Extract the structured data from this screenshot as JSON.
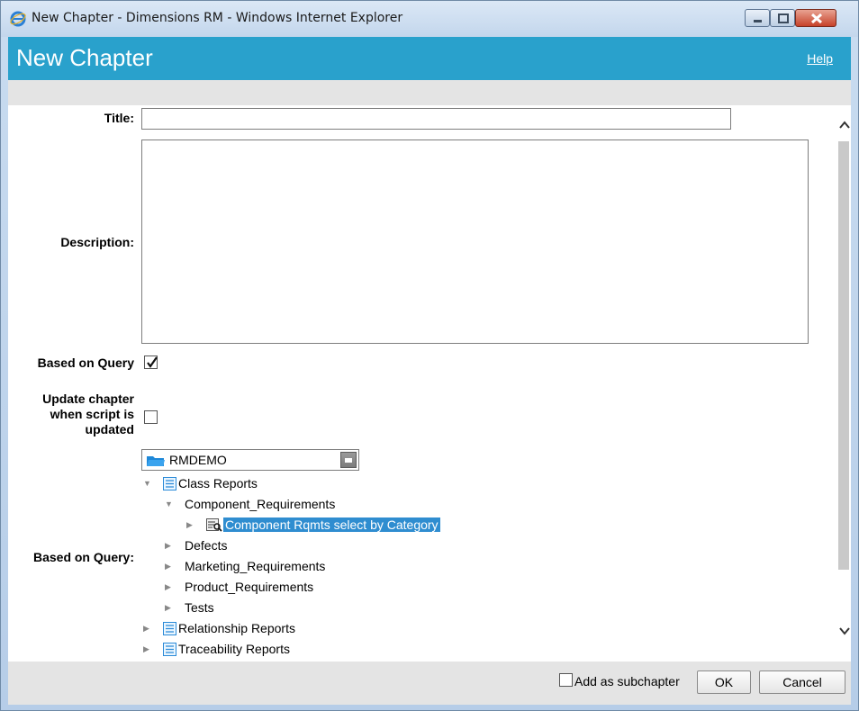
{
  "window": {
    "title": "New Chapter - Dimensions RM - Windows Internet Explorer"
  },
  "header": {
    "heading": "New Chapter",
    "help_label": "Help"
  },
  "form": {
    "title_label": "Title:",
    "title_value": "",
    "description_label": "Description:",
    "description_value": "",
    "based_on_query_label": "Based on Query",
    "based_on_query_checked": true,
    "update_chapter_label_line1": "Update chapter",
    "update_chapter_label_line2": "when script is",
    "update_chapter_label_line3": "updated",
    "update_chapter_checked": false,
    "query_tree_label": "Based on Query:"
  },
  "project_select": {
    "value": "RMDEMO",
    "icon": "folder-icon"
  },
  "tree": [
    {
      "label": "Class Reports",
      "icon": "report-list-icon",
      "expanded": true,
      "level": 0
    },
    {
      "label": "Component_Requirements",
      "expanded": true,
      "level": 1
    },
    {
      "label": "Component Rqmts select by Category",
      "icon": "query-icon",
      "selected": true,
      "level": 2
    },
    {
      "label": "Defects",
      "level": 1
    },
    {
      "label": "Marketing_Requirements",
      "level": 1
    },
    {
      "label": "Product_Requirements",
      "level": 1
    },
    {
      "label": "Tests",
      "level": 1
    },
    {
      "label": "Relationship Reports",
      "icon": "report-list-icon",
      "level": 0
    },
    {
      "label": "Traceability Reports",
      "icon": "report-list-icon",
      "level": 0
    }
  ],
  "footer": {
    "subchapter_label": "Add as subchapter",
    "subchapter_checked": false,
    "ok_label": "OK",
    "cancel_label": "Cancel"
  },
  "colors": {
    "header_bg": "#29a1cc",
    "selection_bg": "#2f8dd0"
  }
}
